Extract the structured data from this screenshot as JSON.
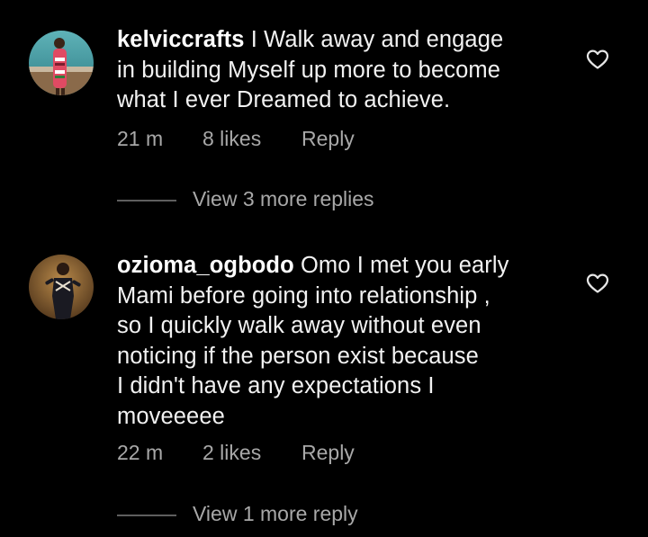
{
  "comments": [
    {
      "username": "kelviccrafts",
      "lines": [
        "I Walk away  and engage",
        "in building Myself up more to become",
        "what I ever Dreamed to achieve."
      ],
      "time": "21 m",
      "likes": "8 likes",
      "reply_label": "Reply",
      "view_replies": "View 3 more replies",
      "heart_icon": "heart-outline-icon"
    },
    {
      "username": "ozioma_ogbodo",
      "lines": [
        "Omo I met you early",
        "Mami before going into relationship ,",
        "so I quickly walk away without even",
        "noticing if the person exist because",
        "I didn't have any expectations I",
        "moveeeee"
      ],
      "time": "22 m",
      "likes": "2 likes",
      "reply_label": "Reply",
      "view_replies": "View 1 more reply",
      "heart_icon": "heart-outline-icon"
    }
  ],
  "colors": {
    "background": "#000000",
    "text": "#f2f2f2",
    "muted": "#a8a8a8"
  }
}
